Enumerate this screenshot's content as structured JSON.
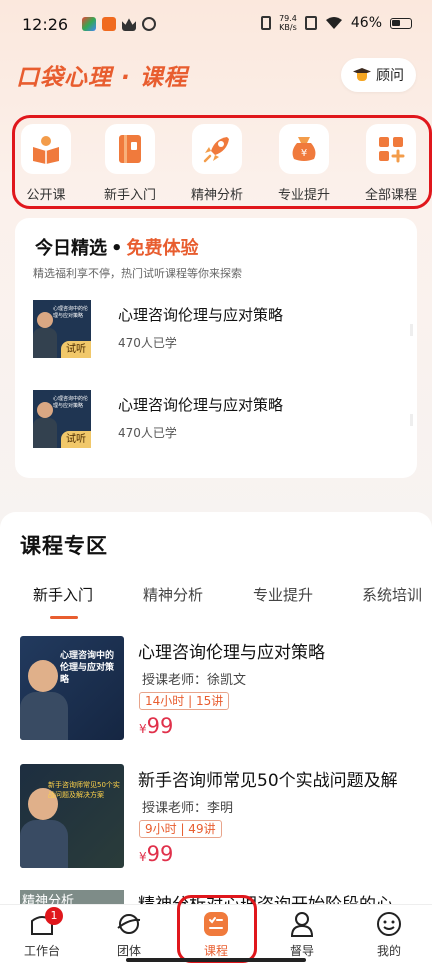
{
  "status_bar": {
    "time": "12:26",
    "net_speed_value": "79.4",
    "net_speed_unit": "KB/s",
    "battery_percent": "46%"
  },
  "header": {
    "title": "口袋心理 · 课程",
    "advisor_label": "顾问"
  },
  "categories": [
    {
      "label": "公开课",
      "icon": "book-reader-icon"
    },
    {
      "label": "新手入门",
      "icon": "notebook-icon"
    },
    {
      "label": "精神分析",
      "icon": "rocket-icon"
    },
    {
      "label": "专业提升",
      "icon": "money-bag-icon"
    },
    {
      "label": "全部课程",
      "icon": "grid-plus-icon"
    }
  ],
  "picks": {
    "title_main": "今日精选",
    "title_dot": "•",
    "title_free": "免费体验",
    "subtitle": "精选福利享不停，热门试听课程等你来探索",
    "items": [
      {
        "title": "心理咨询伦理与应对策略",
        "count": "470人已学",
        "badge": "试听",
        "thumb_text": "心理咨询中的伦理与应对策略"
      },
      {
        "title": "心理咨询伦理与应对策略",
        "count": "470人已学",
        "badge": "试听",
        "thumb_text": "心理咨询中的伦理与应对策略"
      }
    ]
  },
  "zone": {
    "title": "课程专区",
    "tabs": [
      "新手入门",
      "精神分析",
      "专业提升",
      "系统培训"
    ],
    "active_tab": "新手入门",
    "courses": [
      {
        "title": "心理咨询伦理与应对策略",
        "teacher": "授课老师：徐凯文",
        "meta": "14小时 | 15讲",
        "price_symbol": "¥",
        "price": "99",
        "thumb_text": "心理咨询中的伦理与应对策略"
      },
      {
        "title": "新手咨询师常见50个实战问题及解",
        "teacher": "授课老师：李明",
        "meta": "9小时 | 49讲",
        "price_symbol": "¥",
        "price": "99",
        "thumb_text": "新手咨询师常见50个实战问题及解决方案"
      },
      {
        "title": "精神分析对心理咨询开始阶段的心",
        "thumb_label": "精神分析"
      }
    ]
  },
  "bottom_nav": [
    {
      "label": "工作台",
      "icon": "workbench-icon",
      "badge": "1"
    },
    {
      "label": "团体",
      "icon": "planet-icon"
    },
    {
      "label": "课程",
      "icon": "course-icon",
      "active": true
    },
    {
      "label": "督导",
      "icon": "person-icon"
    },
    {
      "label": "我的",
      "icon": "smiley-icon"
    }
  ],
  "colors": {
    "accent": "#e85d2f",
    "highlight_red": "#e0171c",
    "price_red": "#e0304a"
  }
}
